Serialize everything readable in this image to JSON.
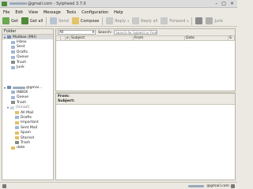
{
  "window": {
    "title_prefix": "",
    "title_suffix": "@gmail.com - Sylpheed 3.7.0",
    "controls": [
      "–",
      "□",
      "×"
    ]
  },
  "menu": [
    "File",
    "Edit",
    "View",
    "Message",
    "Tools",
    "Configuration",
    "Help"
  ],
  "toolbar": {
    "get": "Get",
    "get_all": "Get all",
    "send": "Send",
    "compose": "Compose",
    "reply": "Reply",
    "reply_all": "Reply all",
    "forward": "Forward",
    "junk": "Junk"
  },
  "folder_pane": {
    "header": "Folder",
    "mailbox1": {
      "name": "Mailbox (MH)",
      "folders": [
        "Inbox",
        "Sent",
        "Drafts",
        "Queue",
        "Trash",
        "Junk"
      ]
    },
    "account": {
      "suffix": "@gmai...",
      "folders": [
        "INBOX",
        "Queue",
        "Trash"
      ],
      "gmail_group": "[Gmail]",
      "gmail_folders": [
        "All Mail",
        "Drafts",
        "Important",
        "Sent Mail",
        "Spam",
        "Starred",
        "Trash"
      ],
      "extra": "date"
    }
  },
  "summary": {
    "filter_value": "All",
    "search_label": "Search:",
    "search_placeholder": "Search for Subject or From",
    "columns": {
      "subject": "Subject",
      "from": "From",
      "date": "Date",
      "size": "S"
    }
  },
  "message_view": {
    "from_label": "From:",
    "subject_label": "Subject:"
  },
  "statusbar": {
    "account_suffix": "@gmail.com"
  }
}
